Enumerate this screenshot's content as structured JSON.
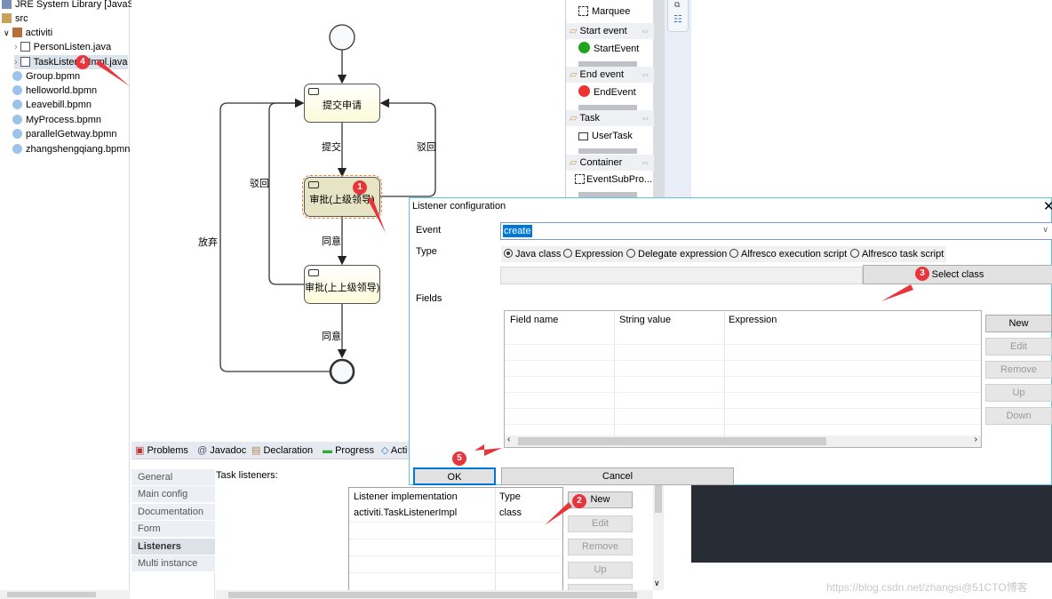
{
  "explorer": {
    "items": [
      {
        "label": "JRE System Library [JavaSE",
        "icon": "library-icon"
      },
      {
        "label": "src",
        "icon": "source-folder-icon"
      },
      {
        "label": "activiti",
        "icon": "package-icon"
      },
      {
        "label": "PersonListen.java",
        "icon": "java-file-icon"
      },
      {
        "label": "TaskListenerImpl.java",
        "icon": "java-file-icon",
        "selected": true
      },
      {
        "label": "Group.bpmn",
        "icon": "bpmn-file-icon"
      },
      {
        "label": "helloworld.bpmn",
        "icon": "bpmn-file-icon"
      },
      {
        "label": "Leavebill.bpmn",
        "icon": "bpmn-file-icon"
      },
      {
        "label": "MyProcess.bpmn",
        "icon": "bpmn-file-icon"
      },
      {
        "label": "parallelGetway.bpmn",
        "icon": "bpmn-file-icon"
      },
      {
        "label": "zhangshengqiang.bpmn",
        "icon": "bpmn-file-icon"
      }
    ]
  },
  "diagram": {
    "tasks": [
      "提交申请",
      "审批(上级领导)",
      "审批(上上级领导)"
    ],
    "flows": {
      "submit": "提交",
      "reject_right": "驳回",
      "reject_left": "驳回",
      "abandon": "放弃",
      "agree1": "同意",
      "agree2": "同意"
    },
    "selected_color": "#e6e4c4",
    "task_color": "#fdfde4"
  },
  "palette": {
    "marquee": "Marquee",
    "sections": [
      {
        "header": "Start event",
        "item": "StartEvent"
      },
      {
        "header": "End event",
        "item": "EndEvent"
      },
      {
        "header": "Task",
        "item": "UserTask"
      },
      {
        "header": "Container",
        "item": "EventSubPro..."
      }
    ]
  },
  "dialog": {
    "title": "Listener configuration",
    "event_label": "Event",
    "event_value": "create",
    "type_label": "Type",
    "type_options": [
      "Java class",
      "Expression",
      "Delegate expression",
      "Alfresco execution script",
      "Alfresco task script"
    ],
    "type_selected": "Java class",
    "class_value": "",
    "select_class": "Select class",
    "fields_label": "Fields",
    "columns": [
      "Field name",
      "String value",
      "Expression"
    ],
    "buttons": [
      "New",
      "Edit",
      "Remove",
      "Up",
      "Down"
    ],
    "ok": "OK",
    "cancel": "Cancel"
  },
  "bottom_tabs": [
    "Problems",
    "Javadoc",
    "Declaration",
    "Progress",
    "Acti"
  ],
  "properties": {
    "sections": [
      "General",
      "Main config",
      "Documentation",
      "Form",
      "Listeners",
      "Multi instance"
    ],
    "active_section": "Listeners",
    "task_listeners_label": "Task listeners:",
    "columns": [
      "Listener implementation",
      "Type"
    ],
    "rows": [
      {
        "impl": "activiti.TaskListenerImpl",
        "type": "class"
      }
    ],
    "buttons": [
      "New",
      "Edit",
      "Remove",
      "Up"
    ]
  },
  "annotations": [
    "1",
    "2",
    "3",
    "4",
    "5"
  ],
  "watermark": "https://blog.csdn.net/zhangsi@51CTO博客"
}
